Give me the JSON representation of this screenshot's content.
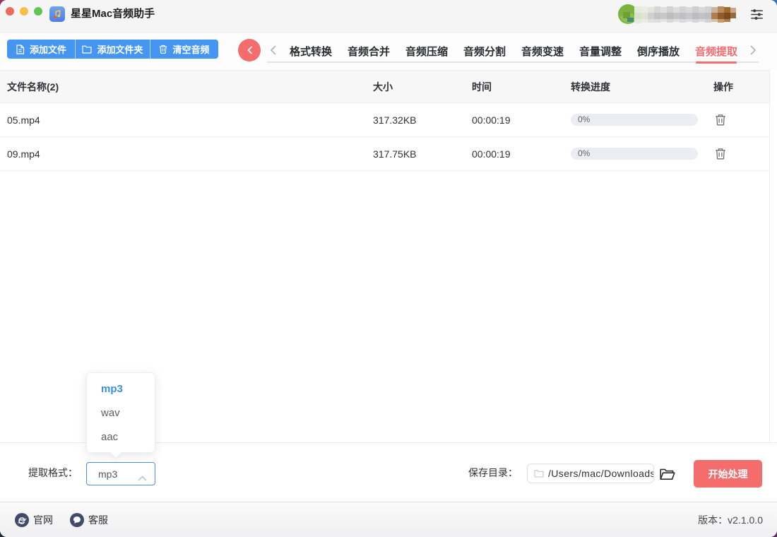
{
  "window": {
    "title": "星星Mac音频助手"
  },
  "toolbar": {
    "add_file": "添加文件",
    "add_folder": "添加文件夹",
    "clear_audio": "清空音频"
  },
  "tabs": {
    "items": [
      "格式转换",
      "音频合并",
      "音频压缩",
      "音频分割",
      "音频变速",
      "音量调整",
      "倒序播放",
      "音频提取"
    ],
    "active": "音频提取"
  },
  "table": {
    "headers": {
      "name": "文件名称(2)",
      "size": "大小",
      "time": "时间",
      "progress": "转换进度",
      "action": "操作"
    },
    "rows": [
      {
        "name": "05.mp4",
        "size": "317.32KB",
        "time": "00:00:19",
        "progress": "0%"
      },
      {
        "name": "09.mp4",
        "size": "317.75KB",
        "time": "00:00:19",
        "progress": "0%"
      }
    ]
  },
  "format_bar": {
    "label": "提取格式：",
    "selected": "mp3",
    "options": [
      "mp3",
      "wav",
      "aac"
    ]
  },
  "save_bar": {
    "label": "保存目录：",
    "path": "/Users/mac/Downloads",
    "start_button": "开始处理"
  },
  "footer": {
    "website": "官网",
    "support": "客服",
    "version": "版本：v2.1.0.0"
  },
  "colors": {
    "primary_blue": "#4596F2",
    "danger_red": "#F56C6C",
    "active_tab_red": "#F56C6C",
    "link_blue": "#3A8EE6",
    "progress_track": "#EBEDF5",
    "table_header_bg": "#F7F7F8"
  }
}
